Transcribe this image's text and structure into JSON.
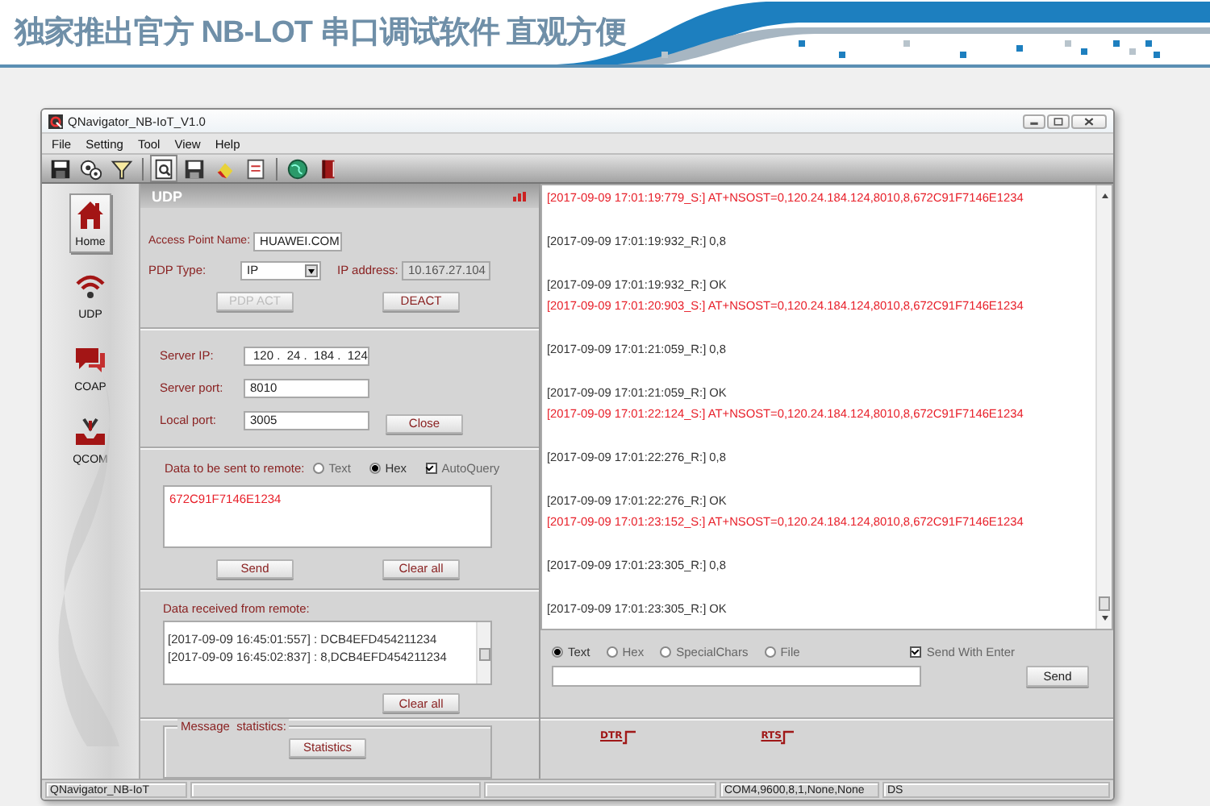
{
  "banner": {
    "title": "独家推出官方 NB-LOT 串口调试软件 直观方便"
  },
  "window": {
    "title": "QNavigator_NB-IoT_V1.0"
  },
  "menu": [
    "File",
    "Setting",
    "Tool",
    "View",
    "Help"
  ],
  "toolbar": [
    {
      "kind": "save",
      "selected": false
    },
    {
      "kind": "gears",
      "selected": false
    },
    {
      "kind": "filter",
      "selected": false
    },
    {
      "kind": "separator"
    },
    {
      "kind": "search-doc",
      "selected": true
    },
    {
      "kind": "floppy",
      "selected": false
    },
    {
      "kind": "eraser",
      "selected": false
    },
    {
      "kind": "document",
      "selected": false
    },
    {
      "kind": "separator"
    },
    {
      "kind": "globe",
      "selected": false
    },
    {
      "kind": "book",
      "selected": false
    }
  ],
  "sidebar": {
    "items": [
      {
        "label": "Home",
        "kind": "home",
        "selected": true
      },
      {
        "label": "UDP",
        "kind": "wifi",
        "selected": false
      },
      {
        "label": "COAP",
        "kind": "chat",
        "selected": false
      },
      {
        "label": "QCOM",
        "kind": "tray",
        "selected": false
      }
    ]
  },
  "udp_panel": {
    "title": "UDP",
    "apn": {
      "label": "Access Point Name:",
      "value": "HUAWEI.COM"
    },
    "pdp_type": {
      "label": "PDP Type:",
      "value": "IP"
    },
    "ip_address": {
      "label": "IP address:",
      "value": "10.167.27.104"
    },
    "pdp_buttons": [
      {
        "label": "PDP ACT",
        "disabled": true
      },
      {
        "label": "DEACT",
        "disabled": false
      }
    ],
    "server_ip": {
      "label": "Server IP:",
      "value": "120 .  24 .  184 .  124"
    },
    "server_port": {
      "label": "Server port:",
      "value": "8010"
    },
    "local_port": {
      "label": "Local port:",
      "value": "3005"
    },
    "close_button": "Close",
    "send": {
      "label": "Data to be sent to remote:",
      "formats": [
        {
          "label": "Text",
          "selected": false
        },
        {
          "label": "Hex",
          "selected": true
        }
      ],
      "auto_query": {
        "label": "AutoQuery",
        "checked": true
      },
      "text": "672C91F7146E1234",
      "buttons": [
        "Send",
        "Clear all"
      ]
    },
    "received": {
      "label": "Data received from remote:",
      "lines": [
        "[2017-09-09 16:45:01:557] : DCB4EFD454211234",
        "[2017-09-09 16:45:02:837] : 8,DCB4EFD454211234"
      ],
      "button": "Clear all"
    },
    "statistics": {
      "label": "Message  statistics:",
      "button": "Statistics"
    }
  },
  "log": {
    "entries": [
      {
        "kind": "sent",
        "text": "[2017-09-09 17:01:19:779_S:] AT+NSOST=0,120.24.184.124,8010,8,672C91F7146E1234"
      },
      {
        "kind": "received",
        "text": "[2017-09-09 17:01:19:932_R:] 0,8"
      },
      {
        "kind": "received",
        "text": "[2017-09-09 17:01:19:932_R:] OK"
      },
      {
        "kind": "sent",
        "text": "[2017-09-09 17:01:20:903_S:] AT+NSOST=0,120.24.184.124,8010,8,672C91F7146E1234"
      },
      {
        "kind": "received",
        "text": "[2017-09-09 17:01:21:059_R:] 0,8"
      },
      {
        "kind": "received",
        "text": "[2017-09-09 17:01:21:059_R:] OK"
      },
      {
        "kind": "sent",
        "text": "[2017-09-09 17:01:22:124_S:] AT+NSOST=0,120.24.184.124,8010,8,672C91F7146E1234"
      },
      {
        "kind": "received",
        "text": "[2017-09-09 17:01:22:276_R:] 0,8"
      },
      {
        "kind": "received",
        "text": "[2017-09-09 17:01:22:276_R:] OK"
      },
      {
        "kind": "sent",
        "text": "[2017-09-09 17:01:23:152_S:] AT+NSOST=0,120.24.184.124,8010,8,672C91F7146E1234"
      },
      {
        "kind": "received",
        "text": "[2017-09-09 17:01:23:305_R:] 0,8"
      },
      {
        "kind": "received",
        "text": "[2017-09-09 17:01:23:305_R:] OK"
      }
    ]
  },
  "send_bar": {
    "modes": [
      {
        "label": "Text",
        "selected": true
      },
      {
        "label": "Hex",
        "selected": false
      },
      {
        "label": "SpecialChars",
        "selected": false
      },
      {
        "label": "File",
        "selected": false
      }
    ],
    "send_with_enter": {
      "label": "Send With Enter",
      "checked": true
    },
    "button": "Send"
  },
  "signals": [
    "DTR",
    "RTS"
  ],
  "status_bar": {
    "app": "QNavigator_NB-IoT",
    "port": "COM4,9600,8,1,None,None",
    "column_3": "DS"
  }
}
